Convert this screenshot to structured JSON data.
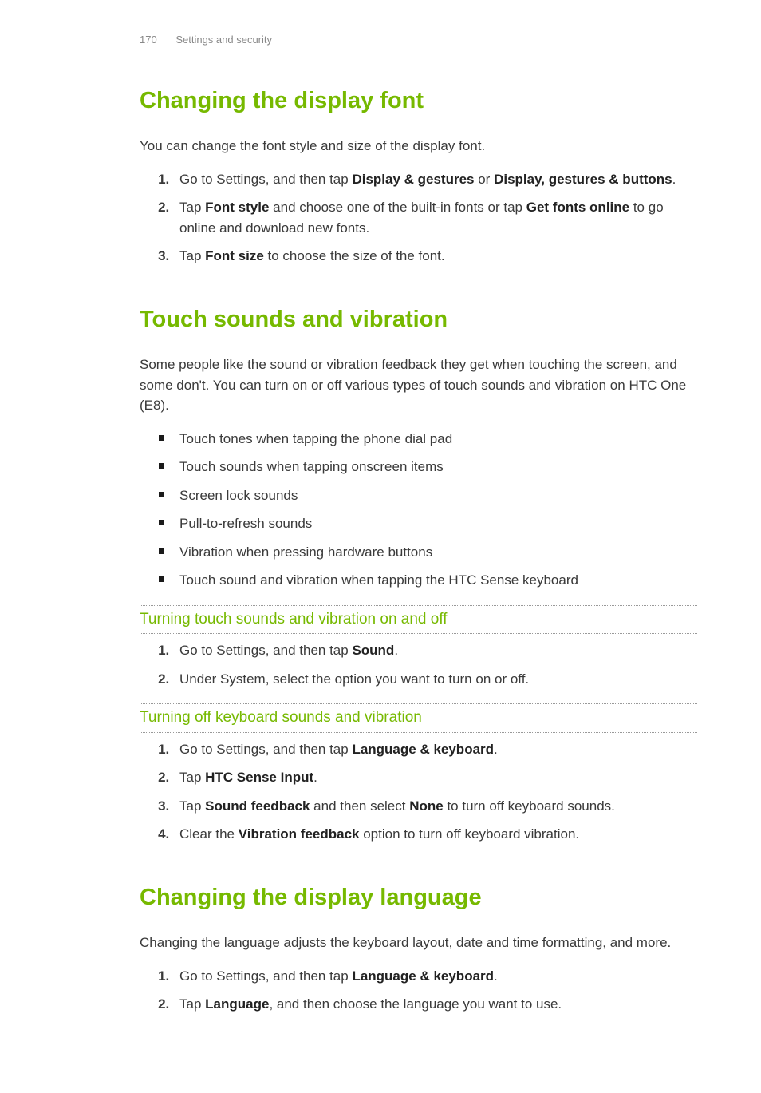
{
  "header": {
    "page_number": "170",
    "section": "Settings and security"
  },
  "section1": {
    "title": "Changing the display font",
    "intro": "You can change the font style and size of the display font.",
    "step1_a": "Go to Settings, and then tap ",
    "step1_b": "Display & gestures",
    "step1_c": " or ",
    "step1_d": "Display, gestures & buttons",
    "step1_e": ".",
    "step2_a": "Tap ",
    "step2_b": "Font style",
    "step2_c": " and choose one of the built-in fonts or tap ",
    "step2_d": "Get fonts online",
    "step2_e": " to go online and download new fonts.",
    "step3_a": "Tap ",
    "step3_b": "Font size",
    "step3_c": " to choose the size of the font."
  },
  "section2": {
    "title": "Touch sounds and vibration",
    "intro": "Some people like the sound or vibration feedback they get when touching the screen, and some don't. You can turn on or off various types of touch sounds and vibration on HTC One (E8).",
    "bullets": [
      "Touch tones when tapping the phone dial pad",
      "Touch sounds when tapping onscreen items",
      "Screen lock sounds",
      "Pull-to-refresh sounds",
      "Vibration when pressing hardware buttons",
      "Touch sound and vibration when tapping the HTC Sense keyboard"
    ],
    "sub1": {
      "title": "Turning touch sounds and vibration on and off",
      "step1_a": "Go to Settings, and then tap ",
      "step1_b": "Sound",
      "step1_c": ".",
      "step2": "Under System, select the option you want to turn on or off."
    },
    "sub2": {
      "title": "Turning off keyboard sounds and vibration",
      "step1_a": "Go to Settings, and then tap ",
      "step1_b": "Language & keyboard",
      "step1_c": ".",
      "step2_a": "Tap ",
      "step2_b": "HTC Sense Input",
      "step2_c": ".",
      "step3_a": "Tap ",
      "step3_b": "Sound feedback",
      "step3_c": " and then select ",
      "step3_d": "None",
      "step3_e": " to turn off keyboard sounds.",
      "step4_a": "Clear the ",
      "step4_b": "Vibration feedback",
      "step4_c": " option to turn off keyboard vibration."
    }
  },
  "section3": {
    "title": "Changing the display language",
    "intro": "Changing the language adjusts the keyboard layout, date and time formatting, and more.",
    "step1_a": "Go to Settings, and then tap ",
    "step1_b": "Language & keyboard",
    "step1_c": ".",
    "step2_a": "Tap ",
    "step2_b": "Language",
    "step2_c": ", and then choose the language you want to use."
  }
}
